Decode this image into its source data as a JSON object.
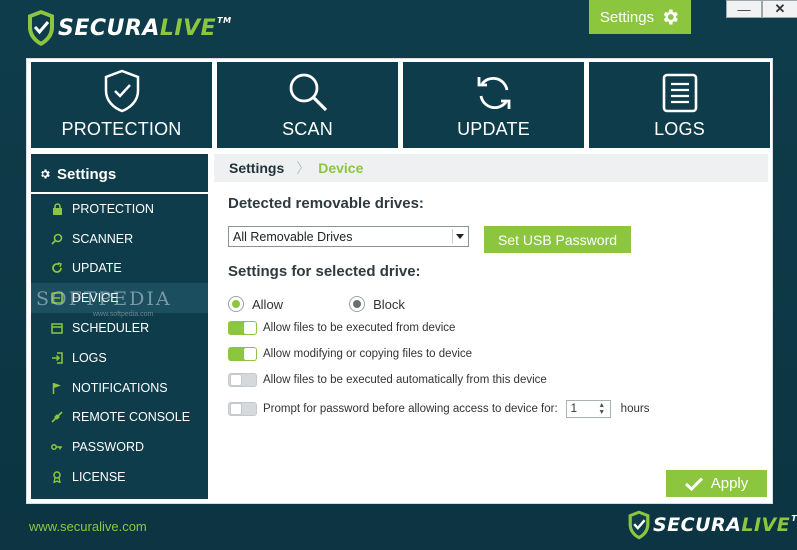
{
  "app": {
    "logo_left": "SECURA",
    "logo_right": "LIVE",
    "logo_tm": "TM",
    "footer_link": "www.securalive.com",
    "watermark": "SOFTPEDIA",
    "watermark_sub": "www.softpedia.com"
  },
  "topbar": {
    "settings_label": "Settings",
    "minimize_symbol": "—",
    "close_symbol": "✕"
  },
  "tiles": [
    {
      "label": "PROTECTION",
      "icon": "shield-check-icon"
    },
    {
      "label": "SCAN",
      "icon": "magnifier-icon"
    },
    {
      "label": "UPDATE",
      "icon": "refresh-icon"
    },
    {
      "label": "LOGS",
      "icon": "list-icon"
    }
  ],
  "sidebar": {
    "title": "Settings",
    "items": [
      {
        "label": "PROTECTION",
        "icon": "lock-icon"
      },
      {
        "label": "SCANNER",
        "icon": "search-icon"
      },
      {
        "label": "UPDATE",
        "icon": "refresh-icon"
      },
      {
        "label": "DEVICE",
        "icon": "drive-icon"
      },
      {
        "label": "SCHEDULER",
        "icon": "calendar-icon"
      },
      {
        "label": "LOGS",
        "icon": "log-in-icon"
      },
      {
        "label": "NOTIFICATIONS",
        "icon": "flag-icon"
      },
      {
        "label": "REMOTE CONSOLE",
        "icon": "remote-icon"
      },
      {
        "label": "PASSWORD",
        "icon": "key-icon"
      },
      {
        "label": "LICENSE",
        "icon": "badge-icon"
      }
    ]
  },
  "breadcrumb": {
    "root": "Settings",
    "current": "Device"
  },
  "device": {
    "detected_title": "Detected removable drives:",
    "drive_select_value": "All Removable Drives",
    "usb_password_button": "Set USB Password",
    "selected_title": "Settings for selected drive:",
    "radio_allow": "Allow",
    "radio_block": "Block",
    "selected_radio": "Allow",
    "opt_execute": "Allow files to be executed from device",
    "opt_modify": "Allow modifying or copying files to device",
    "opt_autorun": "Allow files to be executed automatically from this device",
    "opt_prompt": "Prompt for password before allowing access to device for:",
    "prompt_hours_value": "1",
    "prompt_hours_unit": "hours",
    "opt_execute_on": true,
    "opt_modify_on": true,
    "opt_autorun_on": false,
    "opt_prompt_on": false,
    "apply_button": "Apply"
  },
  "colors": {
    "brand_dark": "#0f3c4b",
    "accent_green": "#8cc63f"
  }
}
